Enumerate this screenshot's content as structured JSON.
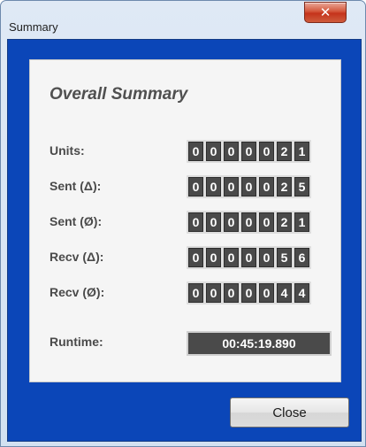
{
  "window": {
    "title": "Summary",
    "close_glyph": "✕"
  },
  "summary": {
    "title": "Overall Summary",
    "rows": [
      {
        "label": "Units:",
        "digits": [
          "0",
          "0",
          "0",
          "0",
          "0",
          "2",
          "1"
        ]
      },
      {
        "label": "Sent (Δ):",
        "digits": [
          "0",
          "0",
          "0",
          "0",
          "0",
          "2",
          "5"
        ]
      },
      {
        "label": "Sent (Ø):",
        "digits": [
          "0",
          "0",
          "0",
          "0",
          "0",
          "2",
          "1"
        ]
      },
      {
        "label": "Recv (Δ):",
        "digits": [
          "0",
          "0",
          "0",
          "0",
          "0",
          "5",
          "6"
        ]
      },
      {
        "label": "Recv (Ø):",
        "digits": [
          "0",
          "0",
          "0",
          "0",
          "0",
          "4",
          "4"
        ]
      }
    ],
    "runtime_label": "Runtime:",
    "runtime_value": "00:45:19.890"
  },
  "footer": {
    "close_label": "Close"
  },
  "colors": {
    "client_background": "#0b46b8",
    "digit_background": "#4a4a4a",
    "close_accent": "#c4331b"
  }
}
